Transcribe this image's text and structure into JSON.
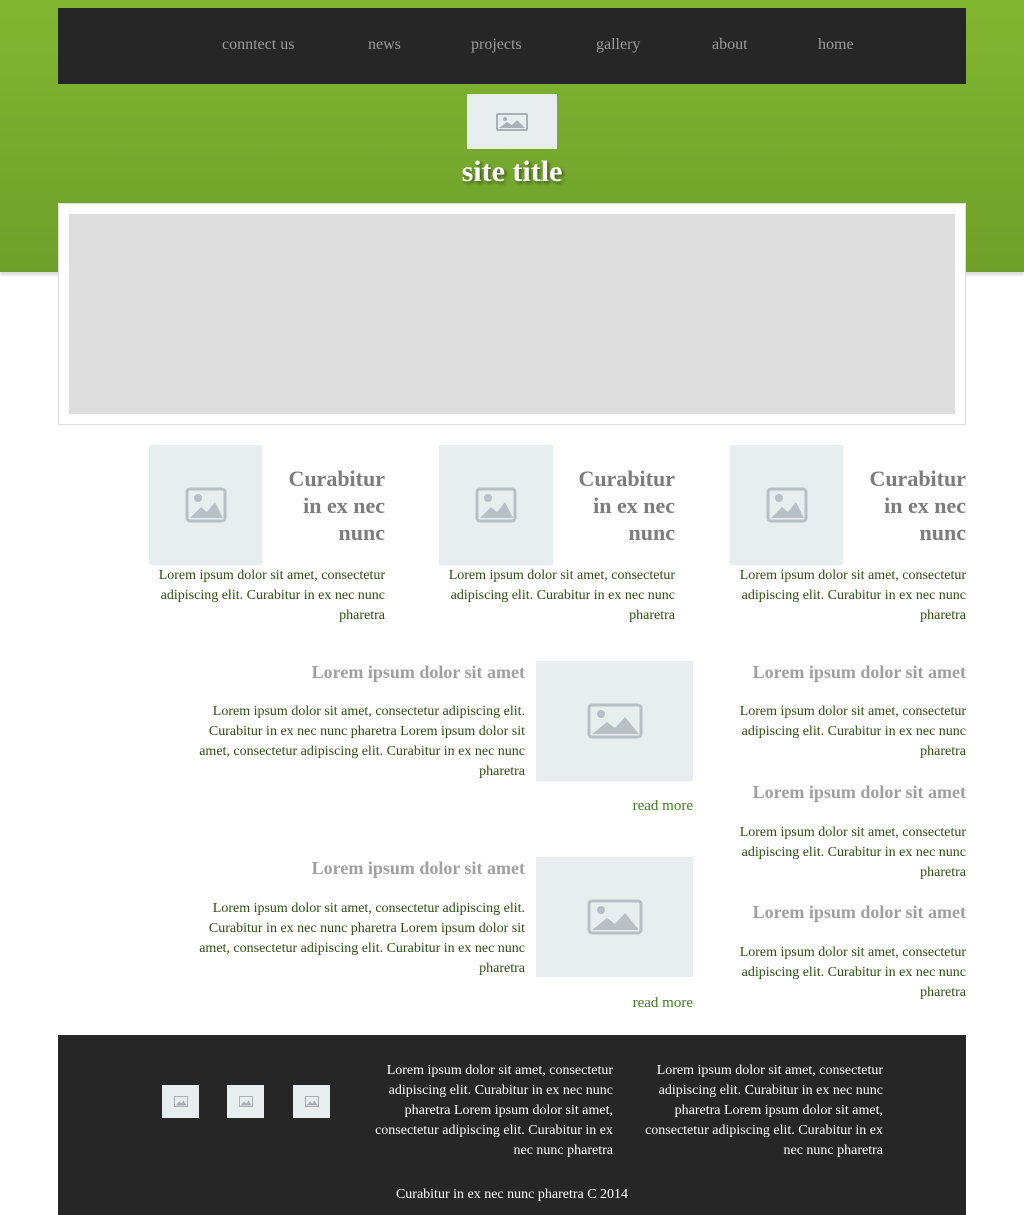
{
  "nav": {
    "items": [
      "conntect us",
      "news",
      "projects",
      "gallery",
      "about",
      "home"
    ]
  },
  "header": {
    "logo_icon": "image-placeholder-icon",
    "site_title": "site title"
  },
  "features": [
    {
      "title": "Curabitur in ex nec nunc",
      "text": "Lorem ipsum dolor sit amet, consectetur adipiscing elit. Curabitur in ex nec nunc pharetra",
      "icon": "image-placeholder-icon"
    },
    {
      "title": "Curabitur in ex nec nunc",
      "text": "Lorem ipsum dolor sit amet, consectetur adipiscing elit. Curabitur in ex nec nunc pharetra",
      "icon": "image-placeholder-icon"
    },
    {
      "title": "Curabitur in ex nec nunc",
      "text": "Lorem ipsum dolor sit amet, consectetur adipiscing elit. Curabitur in ex nec nunc pharetra",
      "icon": "image-placeholder-icon"
    }
  ],
  "posts": [
    {
      "title": "Lorem ipsum dolor sit amet",
      "text": "Lorem ipsum dolor sit amet, consectetur adipiscing elit. Curabitur in ex nec nunc pharetra Lorem ipsum dolor sit amet, consectetur adipiscing elit. Curabitur in ex nec nunc pharetra",
      "read_more": "read more"
    },
    {
      "title": "Lorem ipsum dolor sit amet",
      "text": "Lorem ipsum dolor sit amet, consectetur adipiscing elit. Curabitur in ex nec nunc pharetra Lorem ipsum dolor sit amet, consectetur adipiscing elit. Curabitur in ex nec nunc pharetra",
      "read_more": "read more"
    }
  ],
  "sidebar": [
    {
      "title": "Lorem ipsum dolor sit amet",
      "text": "Lorem ipsum dolor sit amet, consectetur adipiscing elit. Curabitur in ex nec nunc pharetra"
    },
    {
      "title": "Lorem ipsum dolor sit amet",
      "text": "Lorem ipsum dolor sit amet, consectetur adipiscing elit. Curabitur in ex nec nunc pharetra"
    },
    {
      "title": "Lorem ipsum dolor sit amet",
      "text": "Lorem ipsum dolor sit amet, consectetur adipiscing elit. Curabitur in ex nec nunc pharetra"
    }
  ],
  "footer": {
    "social_icons": [
      "image-placeholder-icon",
      "image-placeholder-icon",
      "image-placeholder-icon"
    ],
    "text_col_1": "Lorem ipsum dolor sit amet, consectetur adipiscing elit. Curabitur in ex nec nunc pharetra Lorem ipsum dolor sit amet, consectetur adipiscing elit. Curabitur in ex nec nunc pharetra",
    "text_col_2": "Lorem ipsum dolor sit amet, consectetur adipiscing elit. Curabitur in ex nec nunc pharetra Lorem ipsum dolor sit amet, consectetur adipiscing elit. Curabitur in ex nec nunc pharetra",
    "copyright": "Curabitur in ex nec nunc pharetra C 2014"
  },
  "colors": {
    "brand_green": "#78ad2e",
    "dark": "#262626",
    "placeholder": "#e8edf0",
    "link_green": "#3f7f1e"
  }
}
